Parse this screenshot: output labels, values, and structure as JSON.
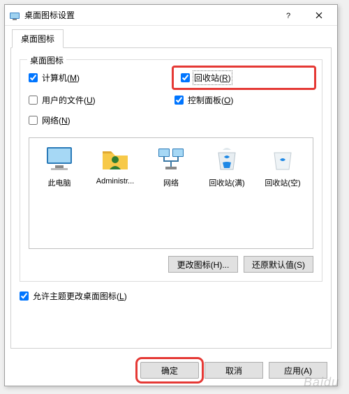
{
  "window": {
    "title": "桌面图标设置"
  },
  "tabs": {
    "desktop": "桌面图标"
  },
  "group": {
    "legend": "桌面图标",
    "checks": {
      "computer": {
        "label": "计算机(",
        "accel": "M",
        "suffix": ")",
        "checked": true
      },
      "recycle": {
        "label": "回收站(",
        "accel": "R",
        "suffix": ")",
        "checked": true
      },
      "userfiles": {
        "label": "用户的文件(",
        "accel": "U",
        "suffix": ")",
        "checked": false
      },
      "control": {
        "label": "控制面板(",
        "accel": "O",
        "suffix": ")",
        "checked": true
      },
      "network": {
        "label": "网络(",
        "accel": "N",
        "suffix": ")",
        "checked": false
      }
    }
  },
  "icons": {
    "thispc": "此电脑",
    "admin": "Administr...",
    "network": "网络",
    "recycle_full": "回收站(满)",
    "recycle_empty": "回收站(空)"
  },
  "buttons": {
    "change_icon": "更改图标(H)...",
    "restore_default": "还原默认值(S)",
    "ok": "确定",
    "cancel": "取消",
    "apply": "应用(A)"
  },
  "theme_check": {
    "label": "允许主题更改桌面图标(",
    "accel": "L",
    "suffix": ")",
    "checked": true
  },
  "watermark": "Baidu"
}
